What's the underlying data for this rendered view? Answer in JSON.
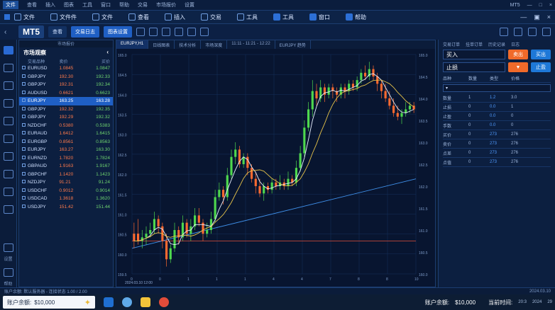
{
  "titlebar": {
    "items": [
      "文件",
      "查看",
      "插入",
      "图表",
      "工具",
      "窗口",
      "帮助",
      "交易",
      "市场报价",
      "设置"
    ],
    "active_index": 0,
    "app_label": "MT5"
  },
  "menubar": {
    "items": [
      {
        "label": "文件"
      },
      {
        "label": "文件件"
      },
      {
        "label": "文件"
      },
      {
        "label": "查看"
      },
      {
        "label": "插入"
      },
      {
        "label": "交易"
      },
      {
        "label": "工具"
      },
      {
        "label": "工具"
      },
      {
        "label": "窗口"
      },
      {
        "label": "帮助"
      }
    ],
    "highlight_indices": [
      7,
      8,
      9
    ]
  },
  "toolbar": {
    "logo": "MT5",
    "view_label": "查看",
    "btn_primary": "交易日志",
    "btn_secondary": "图表设置"
  },
  "leftrail": {
    "bottom_labels": [
      "设置",
      "帮助"
    ]
  },
  "marketwatch": {
    "top_label": "市场报价",
    "title": "市场观察",
    "headers": [
      "交易品种",
      "卖价",
      "买价"
    ],
    "rows": [
      {
        "sym": "EURUSD",
        "bid": "1.0845",
        "ask": "1.0847"
      },
      {
        "sym": "GBPJPY",
        "bid": "192.30",
        "ask": "192.33"
      },
      {
        "sym": "GBPJPY",
        "bid": "192.31",
        "ask": "192.34"
      },
      {
        "sym": "AUDUSD",
        "bid": "0.6621",
        "ask": "0.6623"
      },
      {
        "sym": "EURJPY",
        "bid": "163.25",
        "ask": "163.28"
      },
      {
        "sym": "GBPJPY",
        "bid": "192.32",
        "ask": "192.35"
      },
      {
        "sym": "GBPJPY",
        "bid": "192.29",
        "ask": "192.32"
      },
      {
        "sym": "NZDCHF",
        "bid": "0.5380",
        "ask": "0.5383"
      },
      {
        "sym": "EURAUD",
        "bid": "1.6412",
        "ask": "1.6415"
      },
      {
        "sym": "EURGBP",
        "bid": "0.8561",
        "ask": "0.8563"
      },
      {
        "sym": "EURJPY",
        "bid": "163.27",
        "ask": "163.30"
      },
      {
        "sym": "EURNZD",
        "bid": "1.7820",
        "ask": "1.7824"
      },
      {
        "sym": "GBPAUD",
        "bid": "1.9163",
        "ask": "1.9167"
      },
      {
        "sym": "GBPCHF",
        "bid": "1.1420",
        "ask": "1.1423"
      },
      {
        "sym": "NZDJPY",
        "bid": "91.21",
        "ask": "91.24"
      },
      {
        "sym": "USDCHF",
        "bid": "0.9012",
        "ask": "0.9014"
      },
      {
        "sym": "USDCAD",
        "bid": "1.3618",
        "ask": "1.3620"
      },
      {
        "sym": "USDJPY",
        "bid": "151.42",
        "ask": "151.44"
      }
    ],
    "selected_index": 4
  },
  "chart": {
    "tabs": [
      "EURJPY,H1",
      "日线图表",
      "技术分析",
      "市场深度",
      "11:11 - 11:21 - 12:22",
      "EURJPY 趋势"
    ],
    "active_tab": 0,
    "y_labels": [
      "165.0",
      "164.5",
      "164.0",
      "163.5",
      "163.0",
      "162.5",
      "162.0",
      "161.5",
      "161.0",
      "160.5",
      "160.0",
      "159.5"
    ],
    "x_labels": [
      "0",
      "0",
      "1",
      "1",
      "1",
      "4",
      "4",
      "7",
      "8",
      "8",
      "10"
    ],
    "right_labels": [
      "165.0",
      "164.5",
      "164.0",
      "163.5",
      "163.0",
      "162.5",
      "162.0",
      "161.5",
      "161.0",
      "160.5",
      "160.0"
    ],
    "bottom_date": "2024.03.10 12:00",
    "colors": {
      "up": "#4ed84e",
      "down": "#ff6a30",
      "ma_white": "#e8f0ff",
      "ma_yellow": "#e6c34a",
      "trend": "#3f8fe8",
      "support": "#e0503a"
    }
  },
  "chart_data": {
    "type": "candlestick",
    "candles": [
      [
        1,
        -1,
        4,
        -3
      ],
      [
        1,
        -1,
        5,
        -2
      ],
      [
        -1,
        0,
        2,
        -3
      ],
      [
        0,
        1,
        3,
        -2
      ],
      [
        1,
        2,
        4,
        0
      ],
      [
        2,
        5,
        7,
        1
      ],
      [
        5,
        3,
        6,
        1
      ],
      [
        3,
        -1,
        4,
        -3
      ],
      [
        -1,
        -6,
        1,
        -8
      ],
      [
        -6,
        -3,
        -2,
        -7
      ],
      [
        -3,
        2,
        4,
        -4
      ],
      [
        2,
        0,
        3,
        -2
      ],
      [
        0,
        4,
        6,
        -1
      ],
      [
        4,
        1,
        5,
        0
      ],
      [
        1,
        3,
        5,
        -1
      ],
      [
        3,
        6,
        8,
        2
      ],
      [
        6,
        4,
        8,
        3
      ],
      [
        4,
        1,
        5,
        -1
      ],
      [
        1,
        2,
        4,
        0
      ],
      [
        2,
        5,
        7,
        1
      ],
      [
        5,
        11,
        13,
        4
      ],
      [
        11,
        13,
        15,
        10
      ],
      [
        13,
        11,
        14,
        9
      ],
      [
        11,
        17,
        19,
        10
      ],
      [
        17,
        22,
        24,
        16
      ],
      [
        22,
        24,
        26,
        20
      ],
      [
        24,
        20,
        25,
        19
      ],
      [
        20,
        22,
        23,
        19
      ],
      [
        22,
        19,
        23,
        17
      ],
      [
        19,
        16,
        20,
        15
      ],
      [
        16,
        14,
        18,
        12
      ],
      [
        14,
        12,
        16,
        11
      ],
      [
        12,
        14,
        15,
        10
      ],
      [
        14,
        13,
        15,
        12
      ],
      [
        13,
        15,
        16,
        12
      ],
      [
        15,
        14,
        16,
        13
      ],
      [
        14,
        15,
        17,
        13
      ],
      [
        15,
        14,
        16,
        13
      ],
      [
        14,
        16,
        18,
        13
      ],
      [
        16,
        15,
        17,
        14
      ],
      [
        15,
        19,
        21,
        14
      ],
      [
        19,
        23,
        25,
        18
      ],
      [
        23,
        30,
        32,
        22
      ],
      [
        30,
        35,
        37,
        29
      ],
      [
        35,
        40,
        43,
        33
      ],
      [
        40,
        38,
        42,
        36
      ],
      [
        38,
        41,
        43,
        37
      ],
      [
        41,
        39,
        42,
        37
      ],
      [
        39,
        41,
        42,
        38
      ],
      [
        41,
        40,
        42,
        38
      ],
      [
        40,
        39,
        41,
        37
      ],
      [
        39,
        41,
        42,
        38
      ],
      [
        41,
        40,
        42,
        38
      ],
      [
        40,
        42,
        43,
        39
      ],
      [
        42,
        41,
        43,
        40
      ],
      [
        41,
        43,
        44,
        40
      ],
      [
        43,
        45,
        46,
        42
      ],
      [
        45,
        44,
        47,
        43
      ],
      [
        44,
        46,
        48,
        43
      ],
      [
        46,
        44,
        47,
        43
      ],
      [
        44,
        42,
        45,
        40
      ],
      [
        42,
        40,
        43,
        38
      ],
      [
        40,
        38,
        42,
        37
      ],
      [
        38,
        36,
        40,
        35
      ],
      [
        36,
        34,
        38,
        33
      ],
      [
        34,
        33,
        36,
        32
      ],
      [
        33,
        34,
        35,
        31
      ],
      [
        34,
        35,
        37,
        33
      ],
      [
        35,
        36,
        37,
        34
      ],
      [
        36,
        35,
        37,
        34
      ]
    ],
    "ylim": [
      -10,
      50
    ]
  },
  "orderpanel": {
    "tabs": [
      "交易订单",
      "挂单订单",
      "历史记录",
      "日志"
    ],
    "buy_label": "买入",
    "sell_btn": "卖出",
    "buy_btn": "买出",
    "stop_label": "止损",
    "stop_btn": "止盈",
    "grid_headers": [
      "品种",
      "数量",
      "类型",
      "价格"
    ],
    "grid_rows": [
      {
        "c1": "数量",
        "c2": "1",
        "c3": "1.2",
        "c4": "3.0"
      },
      {
        "c1": "止损",
        "c2": "0",
        "c3": "0.0",
        "c4": "1"
      },
      {
        "c1": "止盈",
        "c2": "0",
        "c3": "0.0",
        "c4": "0"
      },
      {
        "c1": "手数",
        "c2": "0",
        "c3": "0.0",
        "c4": "0"
      },
      {
        "c1": "买价",
        "c2": "0",
        "c3": "273",
        "c4": "276"
      },
      {
        "c1": "卖价",
        "c2": "0",
        "c3": "273",
        "c4": "276"
      },
      {
        "c1": "点差",
        "c2": "0",
        "c3": "273",
        "c4": "276"
      },
      {
        "c1": "点值",
        "c2": "0",
        "c3": "273",
        "c4": "276"
      }
    ]
  },
  "statusbar": {
    "left": "账户余额: 默认服务器 - 连接状态 1.00 / 2.00",
    "date": "2024.03.10"
  },
  "taskbar": {
    "balance_label": "账户余额:",
    "balance_value": "$10,000",
    "tray_balance_label": "账户余额:",
    "tray_balance_value": "$10,000",
    "tray_time_label": "当前时间:",
    "tray_time": "20:3",
    "tray_date": "2024",
    "tray_small": "29"
  }
}
